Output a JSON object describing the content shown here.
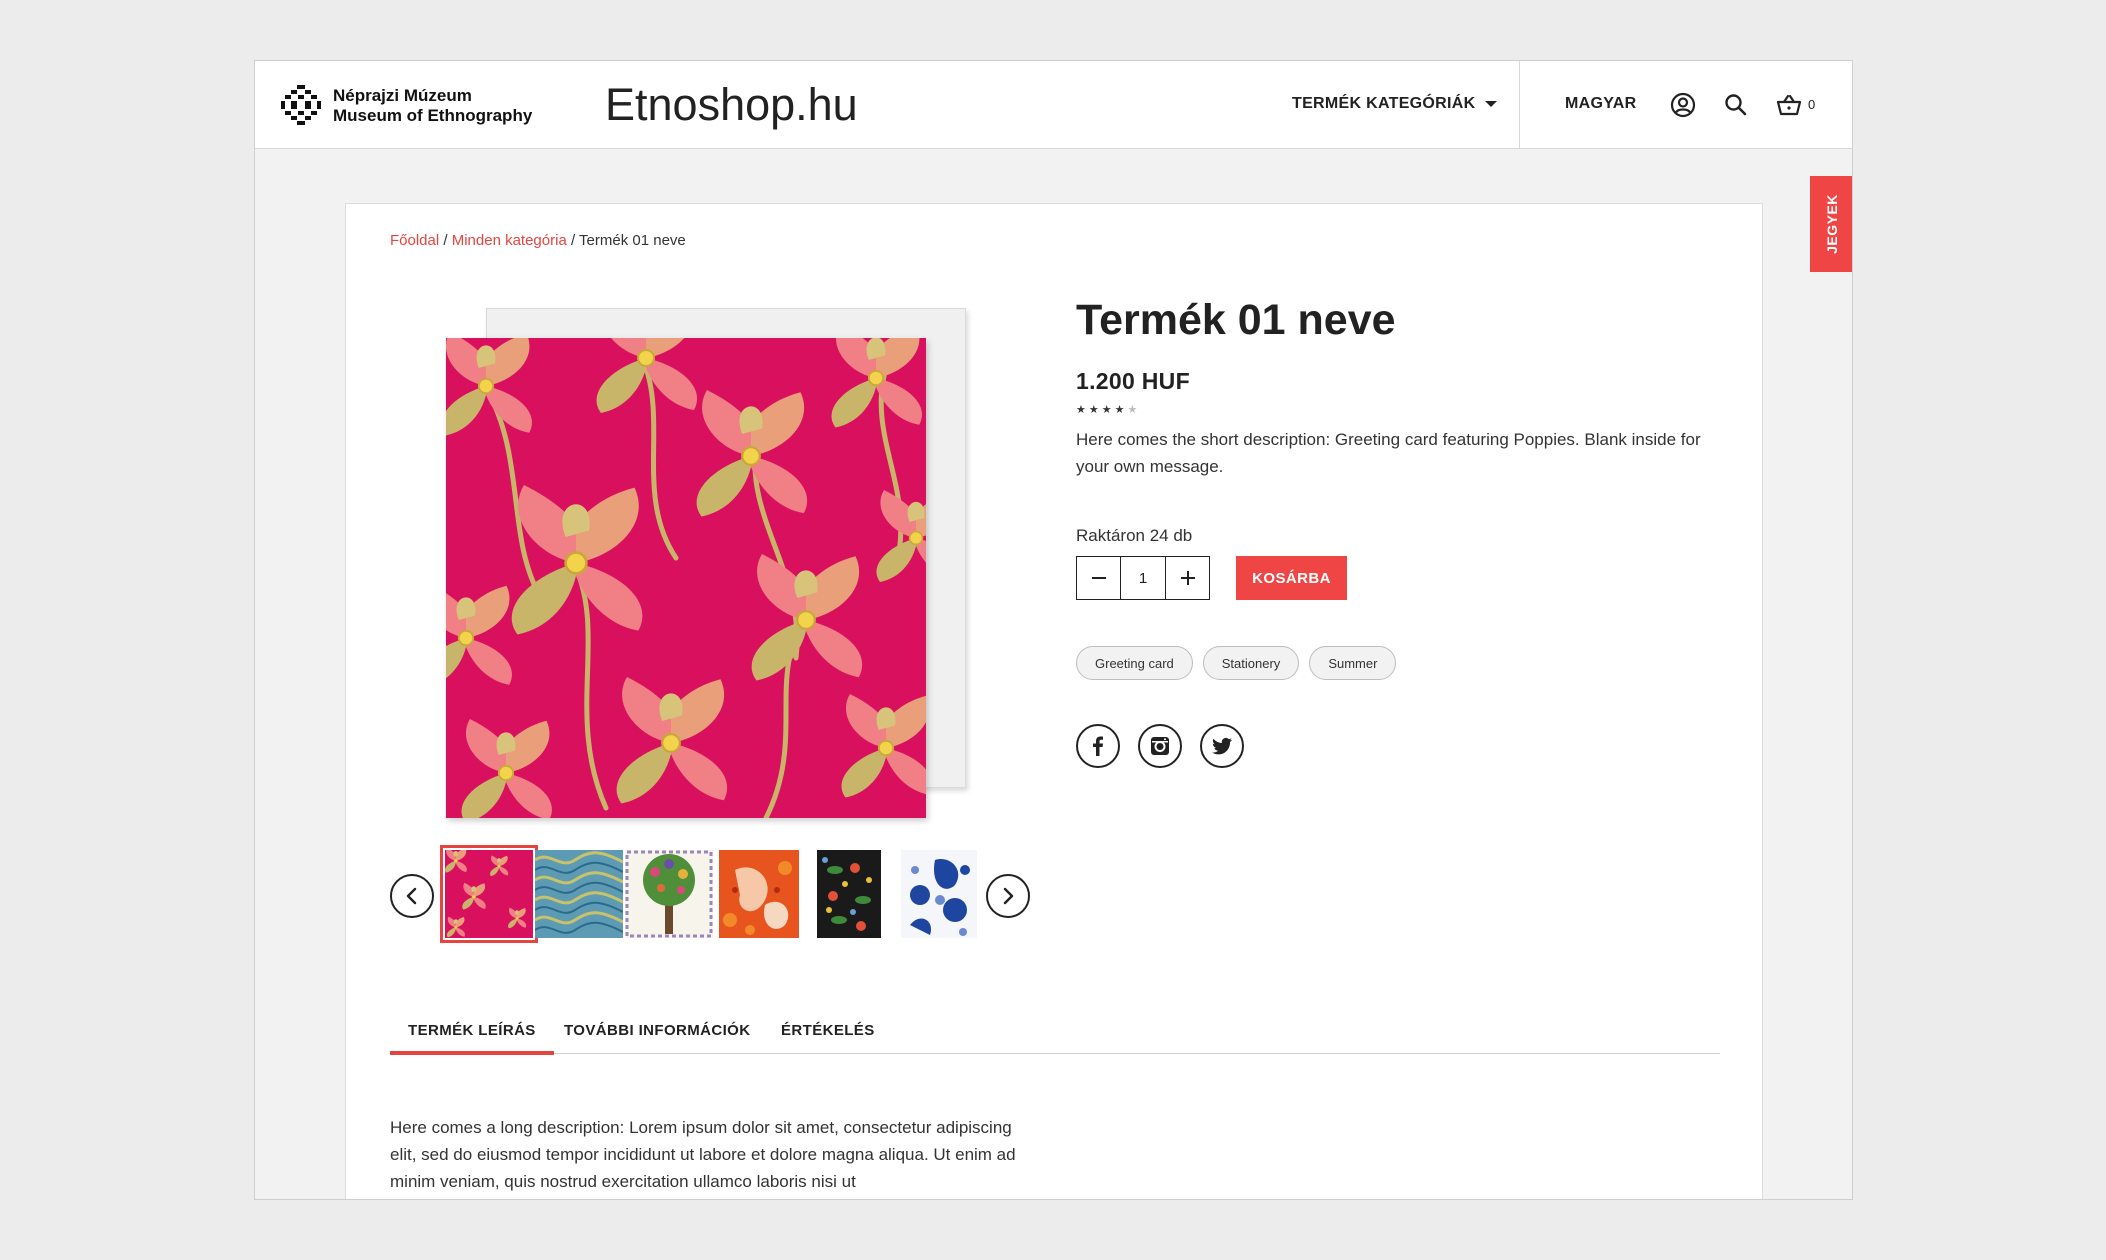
{
  "header": {
    "logo_line1": "Néprajzi Múzeum",
    "logo_line2": "Museum of Ethnography",
    "site_title": "Etnoshop.hu",
    "nav_categories": "TERMÉK KATEGÓRIÁK",
    "language": "MAGYAR",
    "cart_count": "0",
    "icons": [
      "account-icon",
      "search-icon",
      "cart-icon"
    ]
  },
  "side_tab": {
    "label": "JEGYEK"
  },
  "breadcrumb": {
    "home": "Főoldal",
    "category": "Minden kategória",
    "current": "Termék 01 neve",
    "separator": "/"
  },
  "product": {
    "title": "Termék 01 neve",
    "price": "1.200 HUF",
    "rating": 4,
    "rating_max": 5,
    "short_description": "Here comes the short description: Greeting card featuring Poppies. Blank inside for your own message.",
    "stock": "Raktáron 24 db",
    "quantity": "1",
    "add_to_cart": "KOSÁRBA",
    "tags": [
      "Greeting card",
      "Stationery",
      "Summer"
    ],
    "social": [
      "facebook-icon",
      "instagram-icon",
      "twitter-icon"
    ],
    "thumbnails": [
      "pink-poppies",
      "blue-waves",
      "tree-of-life",
      "orange-birds",
      "black-floral",
      "blue-white-floral"
    ],
    "active_thumbnail": 0
  },
  "tabs": [
    "TERMÉK LEÍRÁS",
    "TOVÁBBI INFORMÁCIÓK",
    "ÉRTÉKELÉS"
  ],
  "active_tab": 0,
  "long_description": "Here comes a long description: Lorem ipsum dolor sit amet, consectetur adipiscing elit, sed do eiusmod tempor incididunt ut labore et dolore magna aliqua. Ut enim ad minim veniam, quis nostrud exercitation ullamco laboris nisi ut",
  "colors": {
    "accent": "#f04545",
    "card_pink": "#d9105e",
    "poppy_petal": "#f07f86",
    "poppy_gold": "#c8b26a"
  }
}
